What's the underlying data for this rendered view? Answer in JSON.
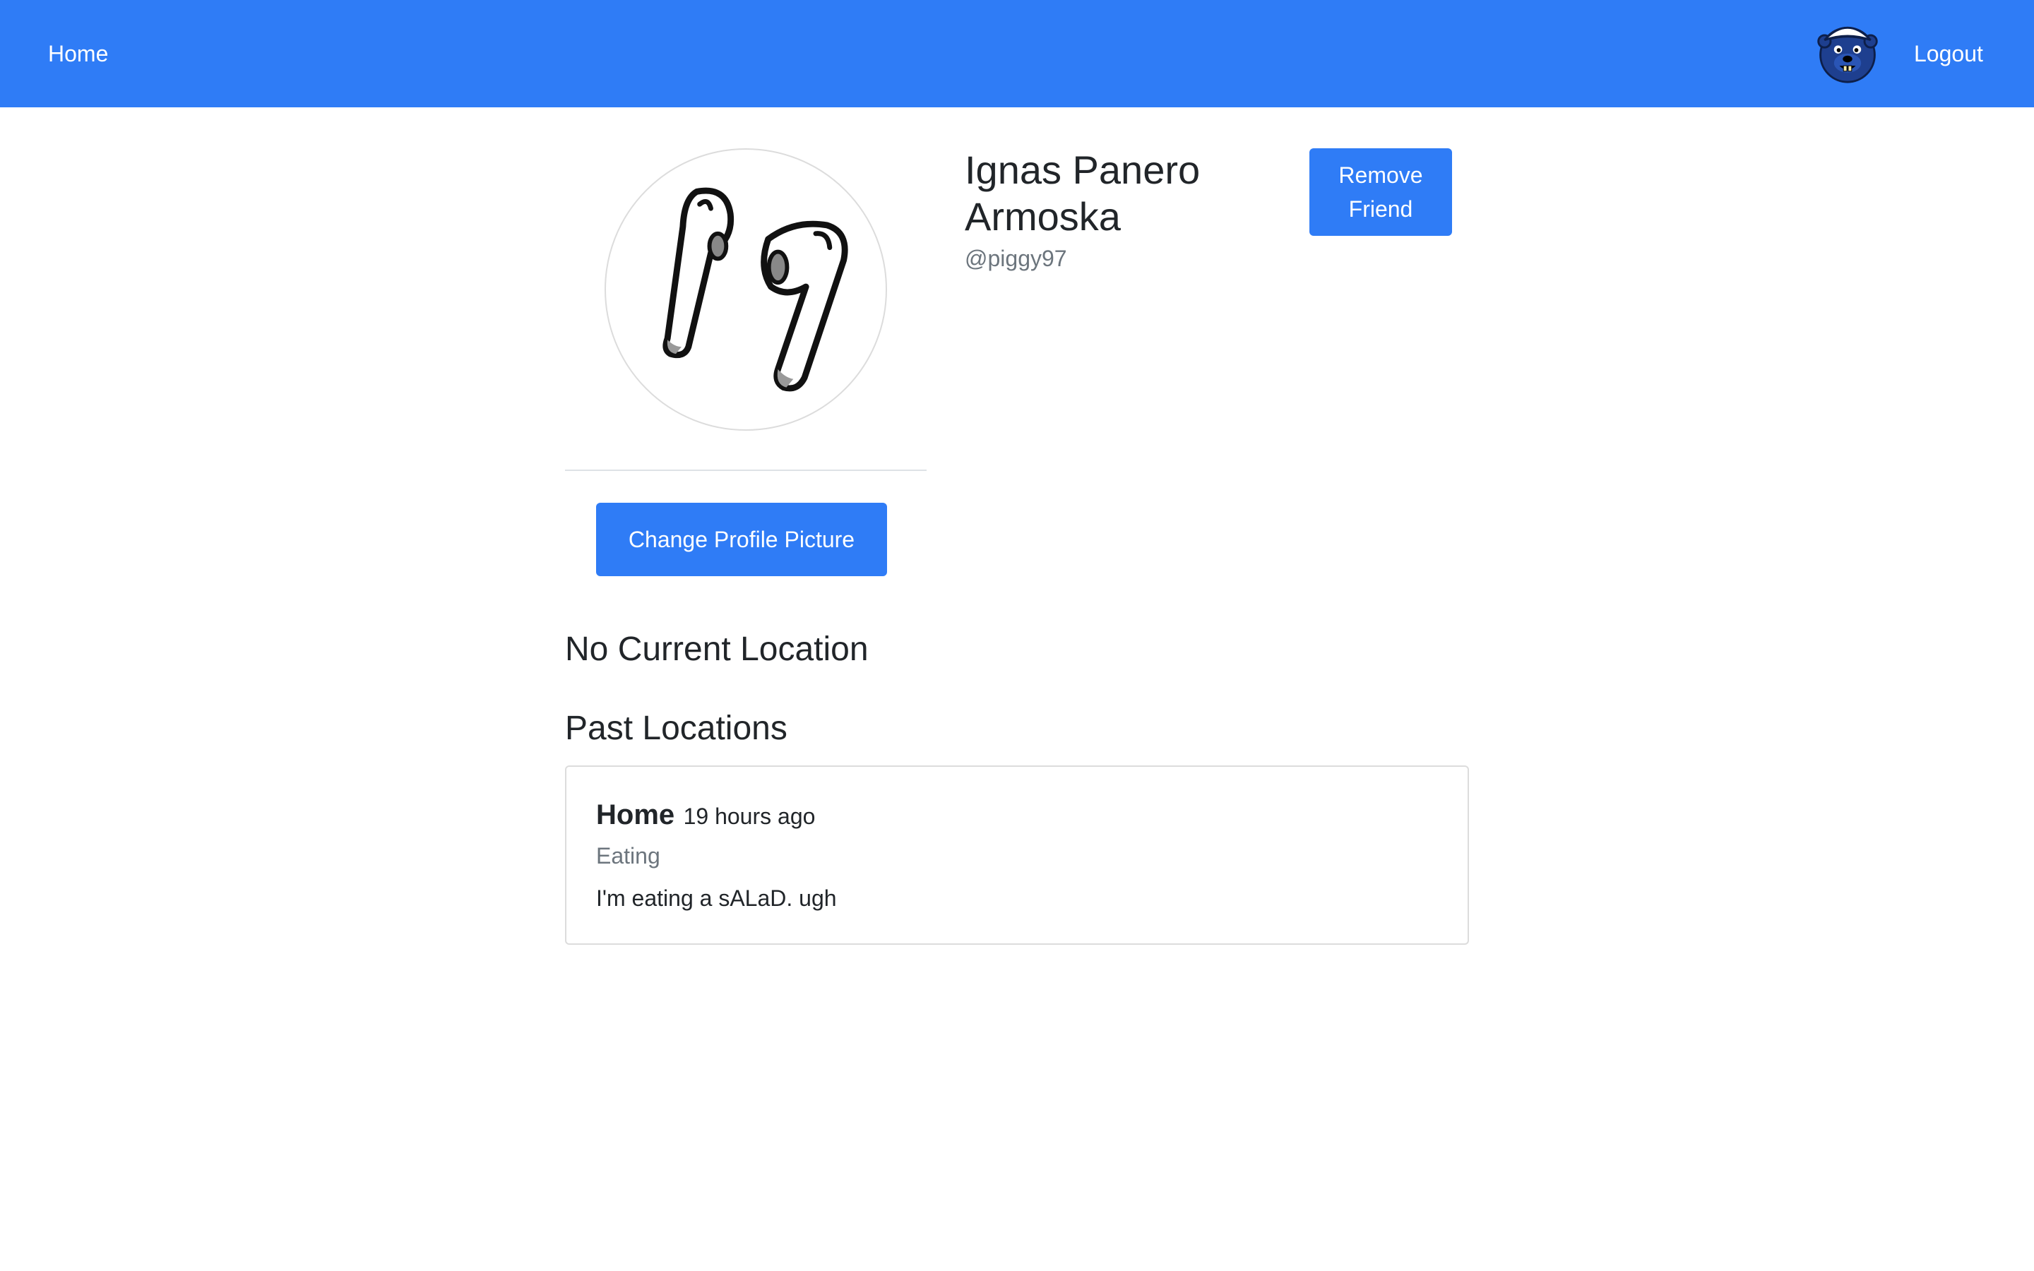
{
  "navbar": {
    "home_label": "Home",
    "logout_label": "Logout",
    "avatar_icon": "beaver-mascot-icon",
    "background_color": "#2f7cf6"
  },
  "profile": {
    "name": "Ignas Panero Armoska",
    "handle": "@piggy97",
    "picture_icon": "earbuds-drawing-icon",
    "change_picture_label": "Change Profile Picture",
    "remove_friend_label": "Remove Friend"
  },
  "locations": {
    "current_heading": "No Current Location",
    "past_heading": "Past Locations",
    "past": [
      {
        "place": "Home",
        "time": "19 hours ago",
        "activity": "Eating",
        "note": "I'm eating a sALaD. ugh"
      }
    ]
  },
  "colors": {
    "accent": "#2f7cf6",
    "muted_text": "#6c757d",
    "body_text": "#212529"
  }
}
